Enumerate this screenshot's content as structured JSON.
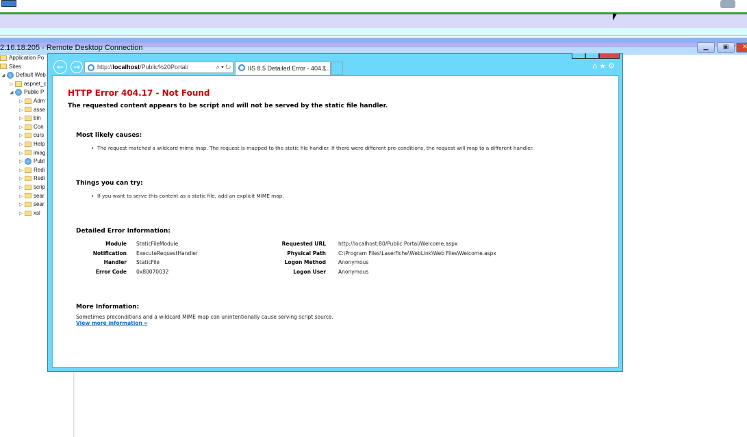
{
  "rdp": {
    "title": "2.16.18.205 - Remote Desktop Connection",
    "buttons": [
      "minimize",
      "restore",
      "close"
    ]
  },
  "tree": {
    "items": [
      {
        "label": "Application Po",
        "icon": "app-pool-icon"
      },
      {
        "label": "Sites",
        "icon": "sites-icon"
      },
      {
        "label": "Default Web",
        "icon": "globe-icon"
      },
      {
        "label": "aspnet_c",
        "icon": "folder-icon"
      },
      {
        "label": "Public P",
        "icon": "globe-icon"
      },
      {
        "label": "Adm",
        "icon": "folder-icon"
      },
      {
        "label": "asse",
        "icon": "folder-icon"
      },
      {
        "label": "bin",
        "icon": "folder-icon"
      },
      {
        "label": "Con",
        "icon": "folder-icon"
      },
      {
        "label": "curs",
        "icon": "folder-icon"
      },
      {
        "label": "Help",
        "icon": "folder-icon"
      },
      {
        "label": "imag",
        "icon": "folder-icon"
      },
      {
        "label": "Publ",
        "icon": "globe-icon"
      },
      {
        "label": "Redi",
        "icon": "folder-icon"
      },
      {
        "label": "Redi",
        "icon": "folder-icon"
      },
      {
        "label": "scrip",
        "icon": "folder-icon"
      },
      {
        "label": "sear",
        "icon": "folder-icon"
      },
      {
        "label": "sear",
        "icon": "folder-icon"
      },
      {
        "label": "xsl",
        "icon": "folder-icon"
      }
    ]
  },
  "browser": {
    "address_prefix": "http://",
    "address_host": "localhost",
    "address_path": "/Public%20Portal/",
    "tab_label": "IIS 8.5 Detailed Error - 404.1...",
    "accent": "#6cd8fb"
  },
  "page": {
    "title": "HTTP Error 404.17 - Not Found",
    "subtitle": "The requested content appears to be script and will not be served by the static file handler.",
    "causes_heading": "Most likely causes:",
    "causes": [
      "The request matched a wildcard mime map. The request is mapped to the static file handler. If there were different pre-conditions, the request will map to a different handler."
    ],
    "try_heading": "Things you can try:",
    "try": [
      "If you want to serve this content as a static file, add an explicit MIME map."
    ],
    "details_heading": "Detailed Error Information:",
    "details_left": [
      {
        "label": "Module",
        "value": "StaticFileModule"
      },
      {
        "label": "Notification",
        "value": "ExecuteRequestHandler"
      },
      {
        "label": "Handler",
        "value": "StaticFile"
      },
      {
        "label": "Error Code",
        "value": "0x80070032"
      }
    ],
    "details_right": [
      {
        "label": "Requested URL",
        "value": "http://localhost:80/Public Portal/Welcome.aspx"
      },
      {
        "label": "Physical Path",
        "value": "C:\\Program Files\\Laserfiche\\WebLink\\Web Files\\Welcome.aspx"
      },
      {
        "label": "Logon Method",
        "value": "Anonymous"
      },
      {
        "label": "Logon User",
        "value": "Anonymous"
      }
    ],
    "more_heading": "More Information:",
    "more_text": "Sometimes preconditions and a wildcard MIME map can unintentionally cause serving script source.",
    "more_link": "View more information »"
  }
}
